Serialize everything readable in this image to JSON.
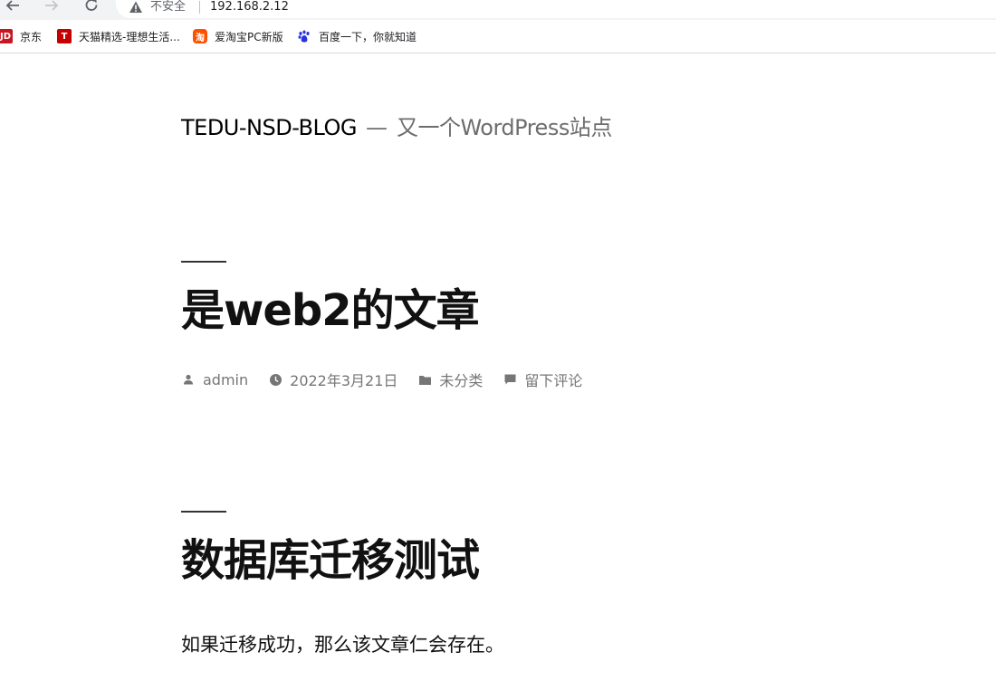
{
  "browser": {
    "security_label": "不安全",
    "url": "192.168.2.12",
    "bookmarks": [
      {
        "label": "京东",
        "icon": "jd-icon",
        "color": "#c81623",
        "glyph": "JD"
      },
      {
        "label": "天猫精选-理想生活...",
        "icon": "tmall-icon",
        "color": "#c40000",
        "glyph": "T"
      },
      {
        "label": "爱淘宝PC新版",
        "icon": "taobao-icon",
        "color": "#ff5000",
        "glyph": "淘"
      },
      {
        "label": "百度一下，你就知道",
        "icon": "baidu-icon",
        "color": "#2932e1",
        "glyph": "🐾"
      }
    ]
  },
  "site": {
    "title": "TEDU-NSD-BLOG",
    "separator": "—",
    "description": "又一个WordPress站点"
  },
  "posts": [
    {
      "title": "是web2的文章",
      "meta": {
        "author": "admin",
        "date": "2022年3月21日",
        "category": "未分类",
        "comments": "留下评论"
      }
    },
    {
      "title": "数据库迁移测试",
      "excerpt": "如果迁移成功，那么该文章仁会存在。"
    }
  ],
  "colors": {
    "title_text": "#111111",
    "meta_text": "#767676",
    "accent_rule": "#333333"
  }
}
